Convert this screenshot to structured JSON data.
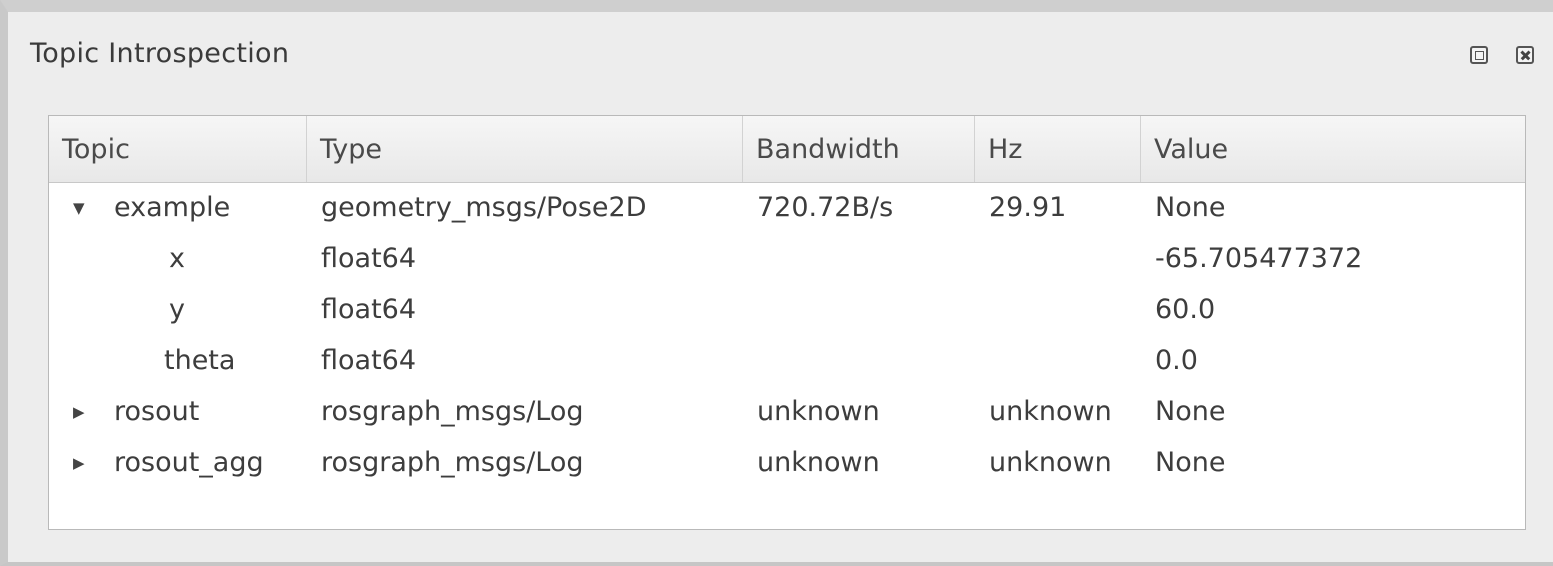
{
  "window": {
    "title": "Topic Introspection",
    "float_icon": "float-restore-icon",
    "close_icon": "close-icon"
  },
  "columns": [
    "Topic",
    "Type",
    "Bandwidth",
    "Hz",
    "Value"
  ],
  "rows": [
    {
      "expander": "▼",
      "topic": "example",
      "type": "geometry_msgs/Pose2D",
      "bandwidth": "720.72B/s",
      "hz": "29.91",
      "value": "None"
    },
    {
      "expander": "",
      "topic": "x",
      "type": "float64",
      "bandwidth": "",
      "hz": "",
      "value": "-65.705477372"
    },
    {
      "expander": "",
      "topic": "y",
      "type": "float64",
      "bandwidth": "",
      "hz": "",
      "value": "60.0"
    },
    {
      "expander": "",
      "topic": "theta",
      "type": "float64",
      "bandwidth": "",
      "hz": "",
      "value": "0.0"
    },
    {
      "expander": "▶",
      "topic": "rosout",
      "type": "rosgraph_msgs/Log",
      "bandwidth": "unknown",
      "hz": "unknown",
      "value": "None"
    },
    {
      "expander": "▶",
      "topic": "rosout_agg",
      "type": "rosgraph_msgs/Log",
      "bandwidth": "unknown",
      "hz": "unknown",
      "value": "None"
    }
  ]
}
